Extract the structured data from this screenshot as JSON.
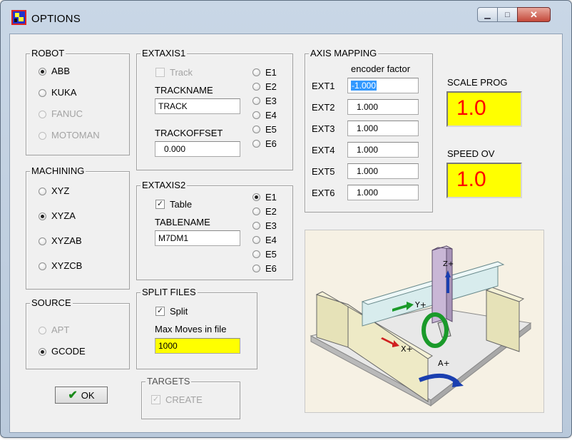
{
  "window": {
    "title": "OPTIONS"
  },
  "robot": {
    "legend": "ROBOT",
    "items": [
      {
        "label": "ABB",
        "selected": true,
        "disabled": false
      },
      {
        "label": "KUKA",
        "selected": false,
        "disabled": false
      },
      {
        "label": "FANUC",
        "selected": false,
        "disabled": true
      },
      {
        "label": "MOTOMAN",
        "selected": false,
        "disabled": true
      }
    ]
  },
  "machining": {
    "legend": "MACHINING",
    "items": [
      {
        "label": "XYZ",
        "selected": false
      },
      {
        "label": "XYZA",
        "selected": true
      },
      {
        "label": "XYZAB",
        "selected": false
      },
      {
        "label": "XYZCB",
        "selected": false
      }
    ]
  },
  "source": {
    "legend": "SOURCE",
    "items": [
      {
        "label": "APT",
        "selected": false,
        "disabled": true
      },
      {
        "label": "GCODE",
        "selected": true,
        "disabled": false
      }
    ]
  },
  "ok": {
    "label": "OK"
  },
  "extaxis1": {
    "legend": "EXTAXIS1",
    "enable_label": "Track",
    "enabled": false,
    "name_label": "TRACKNAME",
    "name_value": "TRACK",
    "offset_label": "TRACKOFFSET",
    "offset_value": "0.000",
    "axes": [
      "E1",
      "E2",
      "E3",
      "E4",
      "E5",
      "E6"
    ],
    "selected_axis": null
  },
  "extaxis2": {
    "legend": "EXTAXIS2",
    "enable_label": "Table",
    "enabled": true,
    "name_label": "TABLENAME",
    "name_value": "M7DM1",
    "axes": [
      "E1",
      "E2",
      "E3",
      "E4",
      "E5",
      "E6"
    ],
    "selected_axis": "E1"
  },
  "split": {
    "legend": "SPLIT FILES",
    "enable_label": "Split",
    "enabled": true,
    "max_label": "Max Moves in file",
    "max_value": "1000"
  },
  "targets": {
    "legend": "TARGETS",
    "create_label": "CREATE",
    "create_checked": true
  },
  "mapping": {
    "legend": "AXIS MAPPING",
    "header": "encoder factor",
    "rows": [
      {
        "label": "EXT1",
        "value": "-1.000"
      },
      {
        "label": "EXT2",
        "value": "1.000"
      },
      {
        "label": "EXT3",
        "value": "1.000"
      },
      {
        "label": "EXT4",
        "value": "1.000"
      },
      {
        "label": "EXT5",
        "value": "1.000"
      },
      {
        "label": "EXT6",
        "value": "1.000"
      }
    ]
  },
  "scale_prog": {
    "label": "SCALE PROG",
    "value": "1.0"
  },
  "speed_ov": {
    "label": "SPEED OV",
    "value": "1.0"
  },
  "picture": {
    "y_axis_label": "Y+",
    "z_axis_label": "Z+",
    "x_axis_label": "X+",
    "a_axis_label": "A+"
  }
}
